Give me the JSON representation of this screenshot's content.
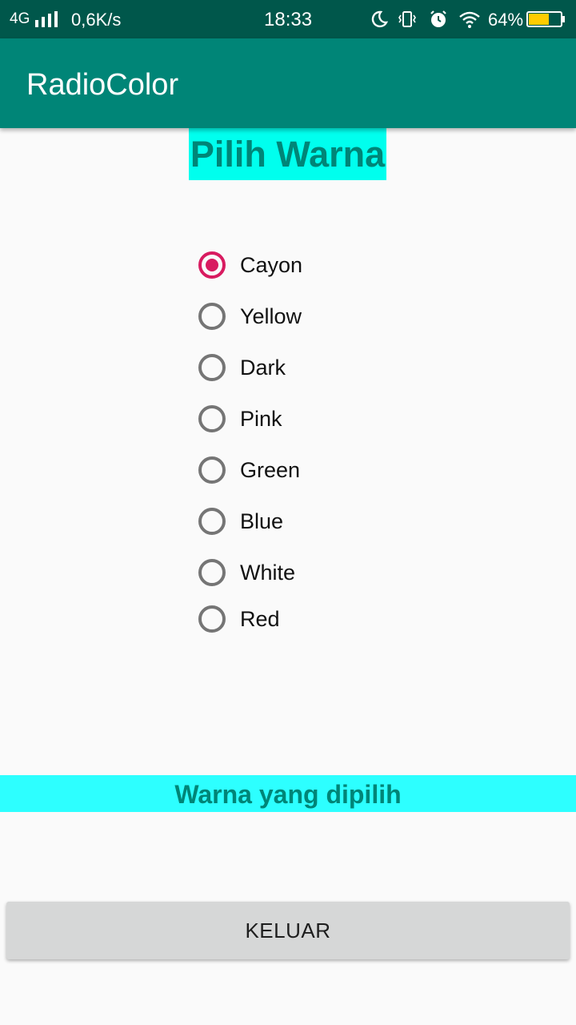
{
  "status_bar": {
    "network": "4G",
    "speed": "0,6K/s",
    "time": "18:33",
    "battery_percent": "64%",
    "icons": [
      "signal-icon",
      "moon-icon",
      "vibrate-icon",
      "alarm-icon",
      "wifi-icon",
      "battery-icon"
    ],
    "battery_level": 0.64,
    "battery_color": "#ffcc00"
  },
  "app_bar": {
    "title": "RadioColor",
    "color": "#008577"
  },
  "heading": {
    "text": "Pilih Warna",
    "background": "#00ffee"
  },
  "radio_group": {
    "selected": "Cayon",
    "options": [
      {
        "label": "Cayon",
        "checked": true
      },
      {
        "label": "Yellow",
        "checked": false
      },
      {
        "label": "Dark",
        "checked": false
      },
      {
        "label": "Pink",
        "checked": false
      },
      {
        "label": "Green",
        "checked": false
      },
      {
        "label": "Blue",
        "checked": false
      },
      {
        "label": "White",
        "checked": false
      },
      {
        "label": "Red",
        "checked": false
      }
    ],
    "accent_color": "#d81b60"
  },
  "result": {
    "text": "Warna yang dipilih",
    "background": "#2dffff"
  },
  "exit_button": {
    "label": "KELUAR"
  }
}
